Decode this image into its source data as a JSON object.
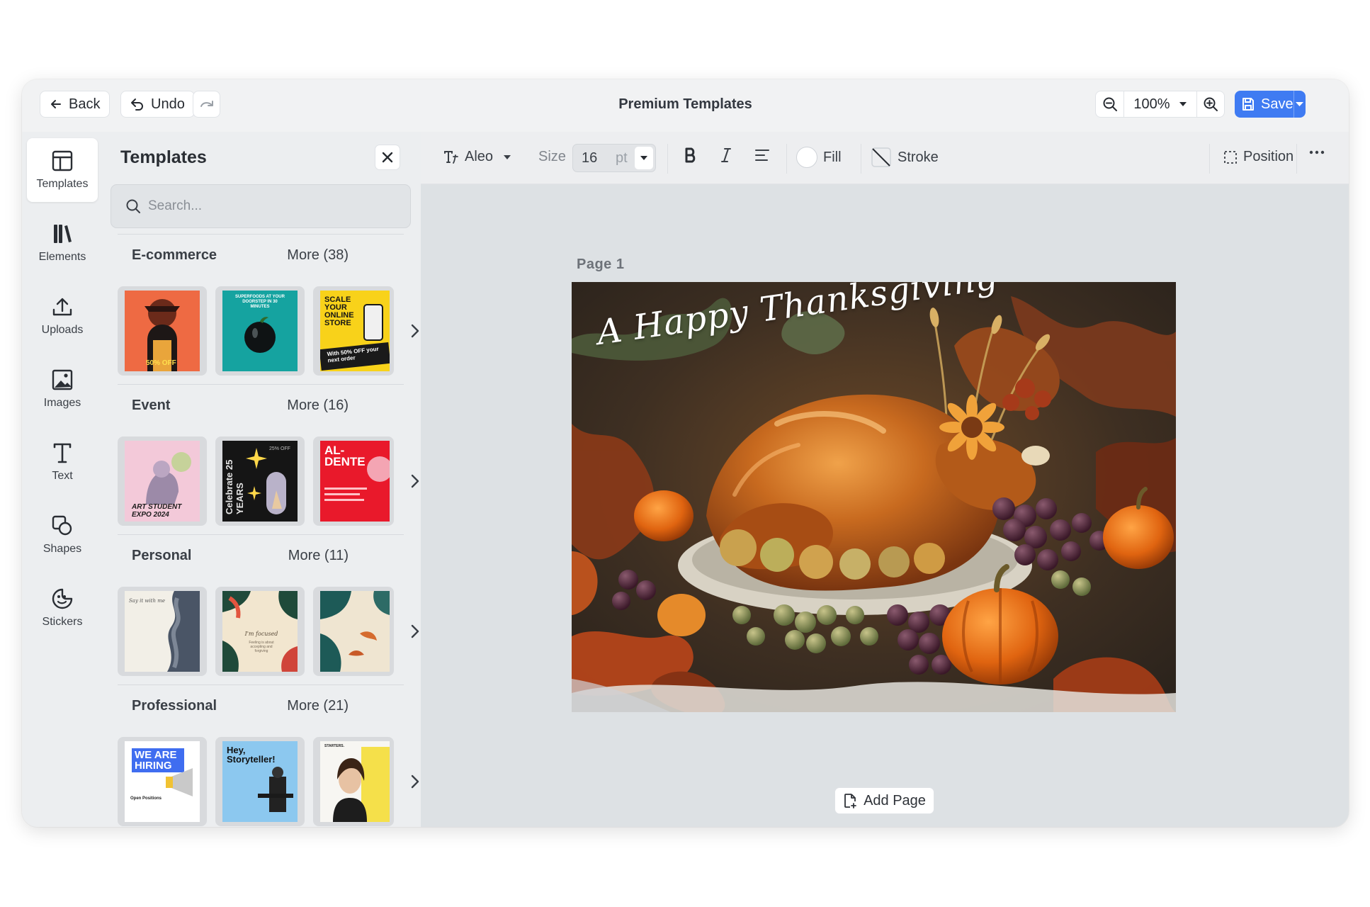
{
  "header": {
    "back_label": "Back",
    "undo_label": "Undo",
    "title": "Premium Templates",
    "zoom": "100%",
    "save_label": "Save"
  },
  "rail": {
    "items": [
      {
        "label": "Templates",
        "icon": "layout-icon"
      },
      {
        "label": "Elements",
        "icon": "library-icon"
      },
      {
        "label": "Uploads",
        "icon": "upload-icon"
      },
      {
        "label": "Images",
        "icon": "image-icon"
      },
      {
        "label": "Text",
        "icon": "text-icon"
      },
      {
        "label": "Shapes",
        "icon": "shapes-icon"
      },
      {
        "label": "Stickers",
        "icon": "sticker-icon"
      }
    ]
  },
  "panel": {
    "title": "Templates",
    "search_placeholder": "Search...",
    "categories": [
      {
        "name": "E-commerce",
        "more": "More (38)",
        "thumbs": [
          {
            "text": "50% OFF"
          },
          {
            "text": "SUPERFOODS AT YOUR DOORSTEP IN 30 MINUTES"
          },
          {
            "text": "SCALE YOUR ONLINE STORE",
            "subtext": "With 50% OFF your next order"
          }
        ]
      },
      {
        "name": "Event",
        "more": "More (16)",
        "thumbs": [
          {
            "text": "ART STUDENT EXPO 2024"
          },
          {
            "text": "Celebrate 25 YEARS",
            "subtext": "25% OFF"
          },
          {
            "text": "AL- DENTE"
          }
        ]
      },
      {
        "name": "Personal",
        "more": "More (11)",
        "thumbs": [
          {
            "text": "Say it with me"
          },
          {
            "text": "I'm focused",
            "subtext": "Feeling is about accepting and forgiving"
          },
          {
            "text": ""
          }
        ]
      },
      {
        "name": "Professional",
        "more": "More (21)",
        "thumbs": [
          {
            "text": "WE ARE HIRING",
            "subtext": "Open Positions"
          },
          {
            "text": "Hey, Storyteller!"
          },
          {
            "text": "STARTERS."
          }
        ]
      }
    ]
  },
  "toolbar": {
    "font": "Aleo",
    "size_label": "Size",
    "size_value": "16",
    "size_unit": "pt",
    "fill_label": "Fill",
    "stroke_label": "Stroke",
    "position_label": "Position"
  },
  "canvas": {
    "page_label": "Page  1",
    "headline": "A Happy Thanksgiving",
    "add_page_label": "Add Page"
  },
  "colors": {
    "accent": "#3f7bf2",
    "background": "#eceef0",
    "canvas_area": "#dde1e4"
  }
}
